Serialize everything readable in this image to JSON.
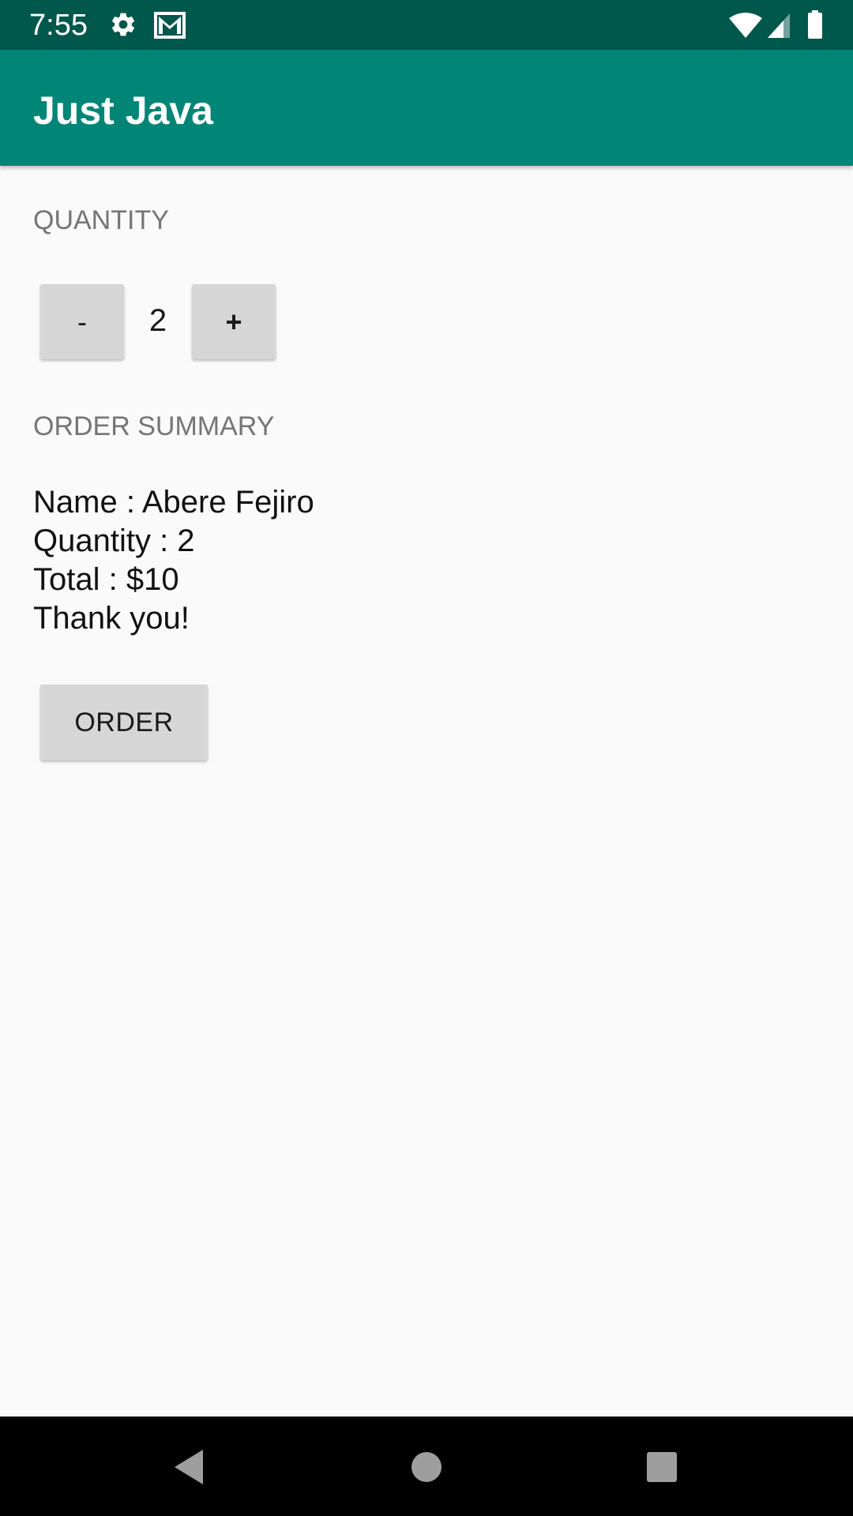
{
  "status_bar": {
    "time": "7:55",
    "icons": [
      "gear-icon",
      "gmail-icon",
      "wifi-icon",
      "signal-icon",
      "battery-icon"
    ],
    "color": "#00574b"
  },
  "app_bar": {
    "title": "Just Java",
    "color": "#008577"
  },
  "quantity_section": {
    "header": "QUANTITY",
    "decrement_label": "-",
    "value": "2",
    "increment_label": "+"
  },
  "summary_section": {
    "header": "ORDER SUMMARY",
    "lines": [
      "Name : Abere Fejiro",
      "Quantity : 2",
      "Total : $10",
      "Thank you!"
    ]
  },
  "order_button": {
    "label": "ORDER"
  },
  "nav_bar": {
    "buttons": [
      "back-icon",
      "home-icon",
      "recents-icon"
    ]
  }
}
